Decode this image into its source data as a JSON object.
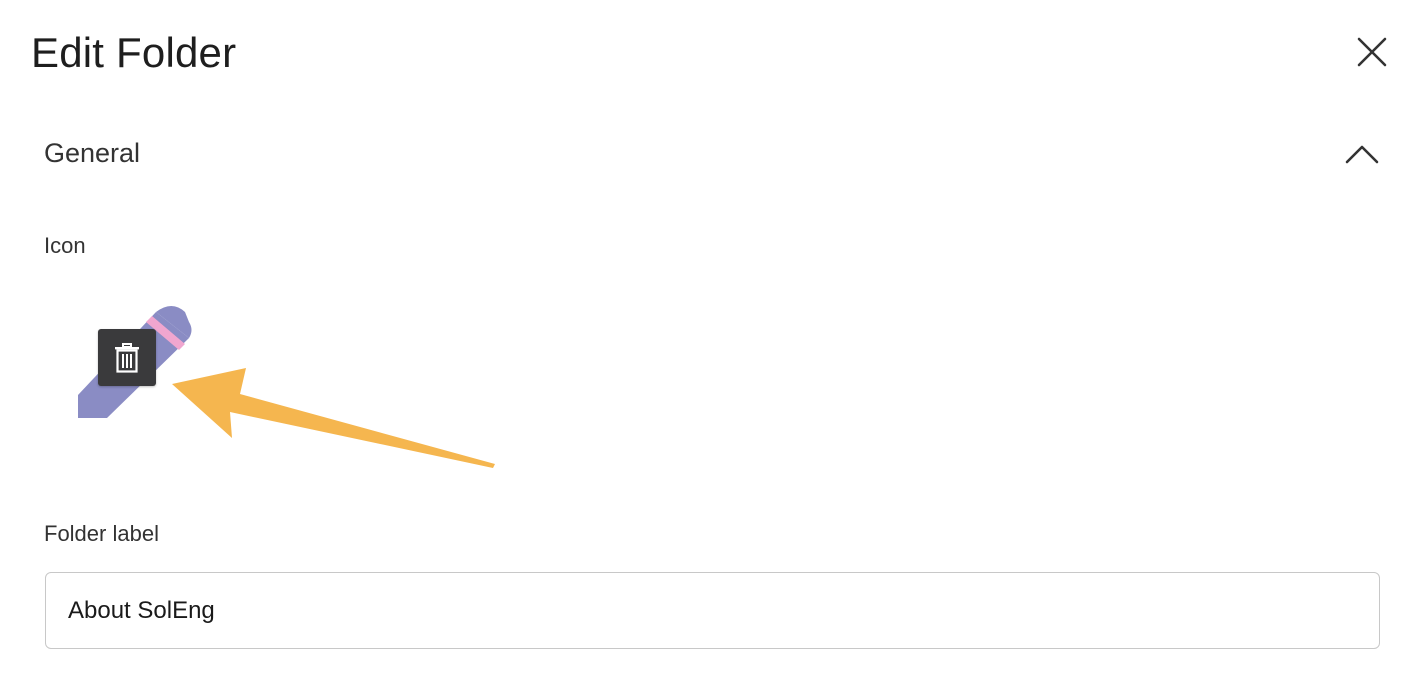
{
  "dialog": {
    "title": "Edit Folder"
  },
  "section": {
    "title": "General",
    "expanded": true
  },
  "icon_field": {
    "label": "Icon",
    "icon": "pencil-icon",
    "icon_color": "#8a8cc4",
    "icon_accent_color": "#f0a6cf",
    "delete_icon": "trash-icon"
  },
  "folder_label_field": {
    "label": "Folder label",
    "value": "About SolEng"
  },
  "annotation": {
    "arrow_color": "#f5b64f"
  }
}
